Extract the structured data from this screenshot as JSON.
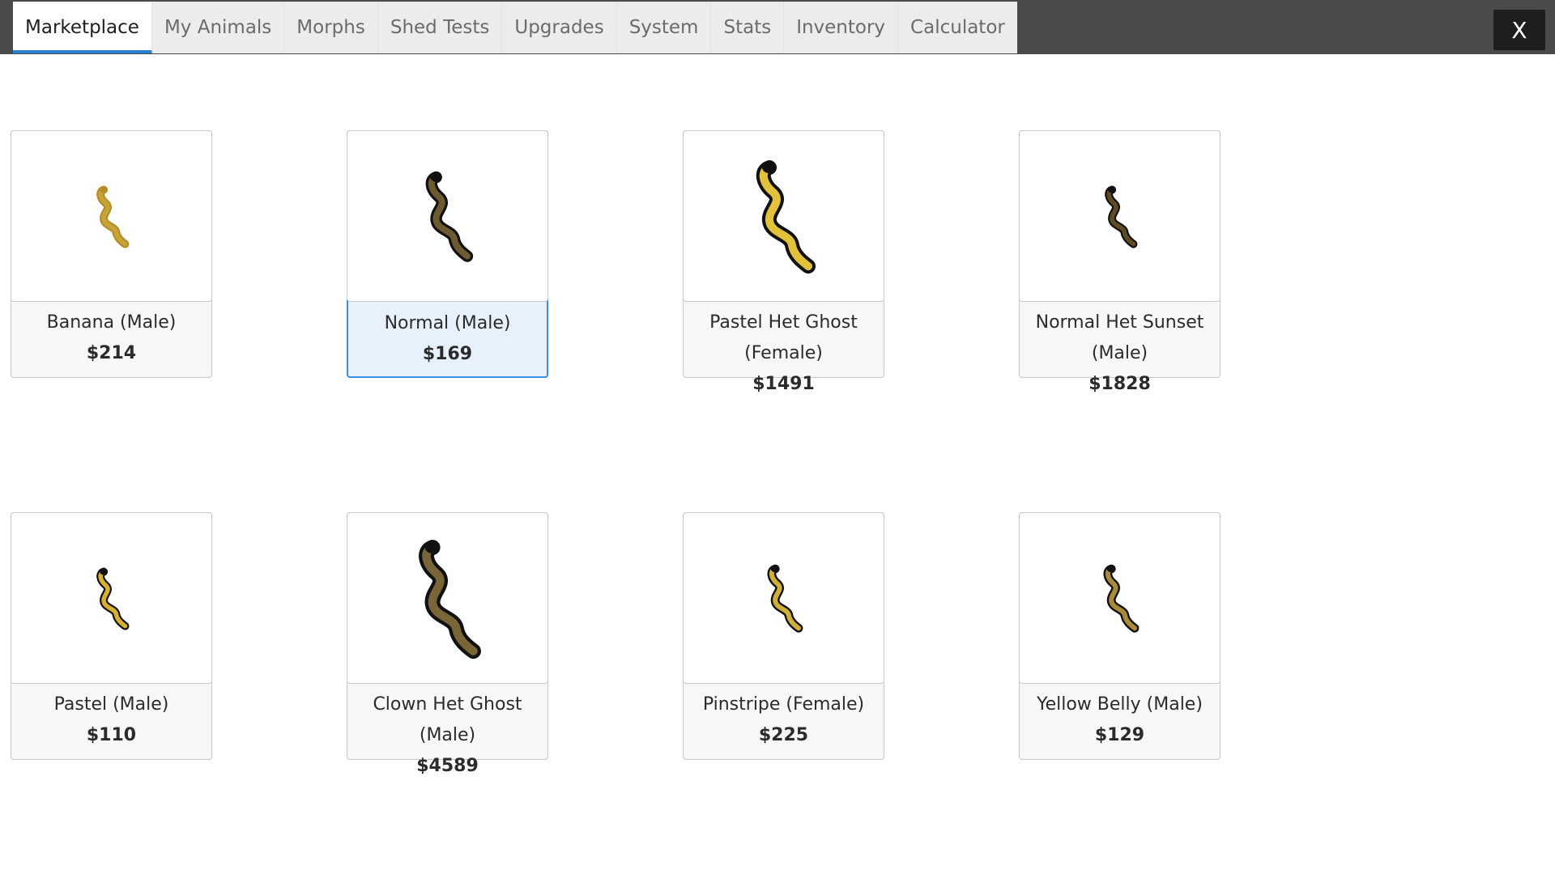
{
  "tabs": [
    {
      "label": "Marketplace",
      "active": true
    },
    {
      "label": "My Animals"
    },
    {
      "label": "Morphs"
    },
    {
      "label": "Shed Tests"
    },
    {
      "label": "Upgrades"
    },
    {
      "label": "System"
    },
    {
      "label": "Stats"
    },
    {
      "label": "Inventory"
    },
    {
      "label": "Calculator"
    }
  ],
  "close_label": "X",
  "listings": [
    {
      "name": "Banana (Male)",
      "price": "$214",
      "color": "#c8a33a",
      "stroke": "#b58d26",
      "size": 0.55,
      "selected": false
    },
    {
      "name": "Normal (Male)",
      "price": "$169",
      "color": "#6e5a30",
      "stroke": "#111111",
      "size": 0.8,
      "selected": true
    },
    {
      "name": "Pastel Het Ghost (Female)",
      "price": "$1491",
      "color": "#e2c23a",
      "stroke": "#111111",
      "size": 1.0,
      "selected": false
    },
    {
      "name": "Normal Het Sunset (Male)",
      "price": "$1828",
      "color": "#5e4c26",
      "stroke": "#111111",
      "size": 0.55,
      "selected": false
    },
    {
      "name": "Pastel (Male)",
      "price": "$110",
      "color": "#d8b030",
      "stroke": "#111111",
      "size": 0.55,
      "selected": false
    },
    {
      "name": "Clown Het Ghost (Male)",
      "price": "$4589",
      "color": "#7a6538",
      "stroke": "#111111",
      "size": 1.05,
      "selected": false
    },
    {
      "name": "Pinstripe (Female)",
      "price": "$225",
      "color": "#cfae3a",
      "stroke": "#111111",
      "size": 0.6,
      "selected": false
    },
    {
      "name": "Yellow Belly (Male)",
      "price": "$129",
      "color": "#a88a38",
      "stroke": "#111111",
      "size": 0.6,
      "selected": false
    }
  ]
}
